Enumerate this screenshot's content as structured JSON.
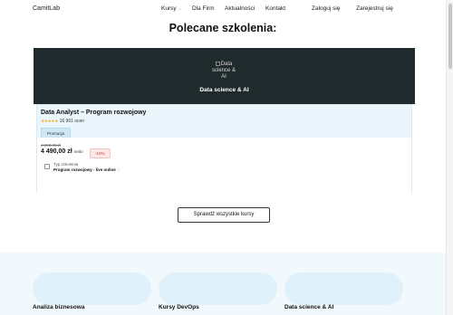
{
  "nav": {
    "logo": "CamitLab",
    "items": [
      {
        "label": "Kursy"
      },
      {
        "label": "Dla Firm"
      },
      {
        "label": "Aktualności"
      },
      {
        "label": "Kontakt"
      },
      {
        "label": "Zaloguj się"
      },
      {
        "label": "Zarejestruj się"
      }
    ]
  },
  "section": {
    "title": "Polecane szkolenia:"
  },
  "card": {
    "image_alt": "Data science & AI",
    "category": "Data science & AI",
    "title": "Data Analyst – Program rozwojowy",
    "stars": "★★★★★",
    "rating_text": "16 991 ocen",
    "badge": "Promocja",
    "old_price": "4 990,00 zł",
    "new_price": "4 490,00 zł",
    "netto": "netto",
    "discount": "-10%",
    "type_label": "Typ szkolenia",
    "type_value": "Program rozwojowy - live online",
    "info_icon": "ⓘ"
  },
  "buttons": {
    "all_courses": "Sprawdź wszystkie kursy"
  },
  "categories": [
    {
      "label": "Analiza biznesowa"
    },
    {
      "label": "Kursy DevOps"
    },
    {
      "label": "Data science & AI"
    }
  ],
  "colors": {
    "card_header_bg": "#1f2a2c",
    "card_body_bg": "#eaf6fb",
    "star_color": "#f5a623",
    "discount_color": "#c0392b",
    "tile_bg": "#dff2fb"
  }
}
